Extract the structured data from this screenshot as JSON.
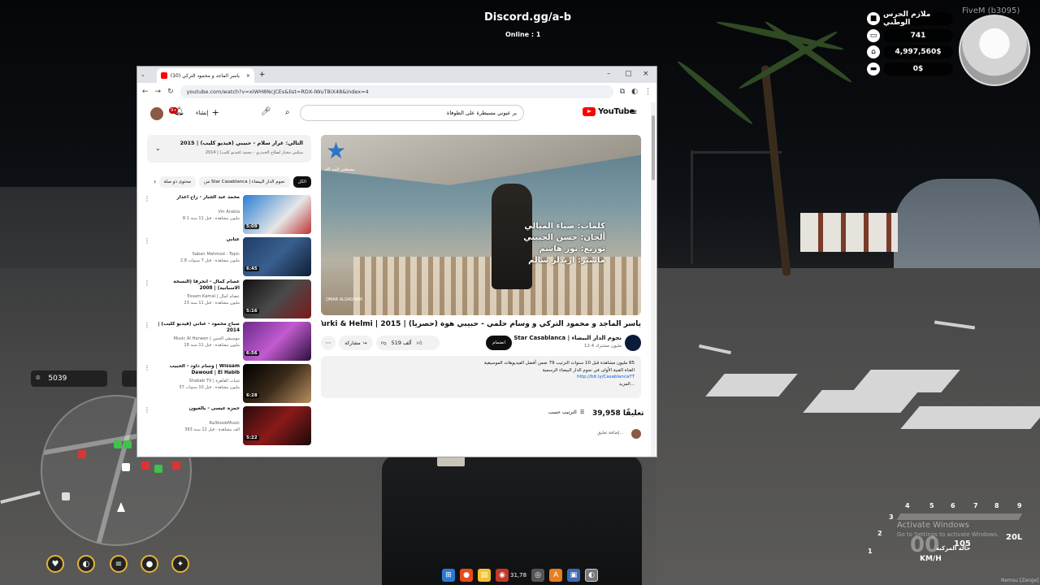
{
  "hud": {
    "discord": "Discord.gg/a-b",
    "online": "Online : 1",
    "fivem": "FiveM (b3095)",
    "rank": "ملازم الحرس الوطني",
    "id": "741",
    "bank": "4,997,560$",
    "cash": "0$",
    "location_code": "5039",
    "speed": "00",
    "speed_unit": "KM/H",
    "fuel": "20L",
    "activate_title": "Activate Windows",
    "activate_sub": "Go to Settings to activate Windows.",
    "vehicle_status": "حالة المركبة",
    "vehicle_num": "105",
    "gears": [
      "1",
      "2",
      "3",
      "4",
      "5",
      "6",
      "7",
      "8",
      "9"
    ],
    "bottom_right": "Nemsu [Zange]",
    "colors": {
      "accent": "#e2b43b",
      "hud_bg": "#000000"
    }
  },
  "taskbar": {
    "icons": [
      "windows-icon",
      "chrome-icon",
      "explorer-icon",
      "discord-icon",
      "steam-icon",
      "app-icon",
      "folder-icon",
      "chrome-active-icon"
    ],
    "badge": "31,78"
  },
  "browser": {
    "tab_title": "(10) ياسر الماجد و محمود التركي",
    "url": "youtube.com/watch?v=xIWH8NcjCEs&list=RDX-IWuT8iX48&index=4",
    "youtube_logo": "YouTube",
    "search_query": "ير عيوني مسيطرة على الطوفاة",
    "create_label": "إنشاء",
    "notif_count": "9+",
    "video": {
      "overlay_lines": [
        "كلمات: ضياء الميالي",
        "ألحان: حسن الحبيبي",
        "توزيع: نور هاشم",
        "ماستر: اريدلر سالم"
      ],
      "logo_text": "مصطفى العبد الله",
      "watermark": "OMAR ALSAGHAM",
      "title": "ياسر الماجد و محمود التركي و وسام حلمي - حبيبي هوة (حصرياً) | 2015 | Al Majed & Al Turki & Helmi",
      "channel": "Star Casablanca | نجوم الدار البيضاء",
      "subs": "12.4 مليون مشترك",
      "join": "انضمام",
      "likes": "519 ألف",
      "share": "مشاركة",
      "description_stats": "85 مليون مشاهدة قبل 10 سنوات  الترتيب 79 ضمن أفضل الفيديوهات الموسيقية",
      "description_line2": "القناة الفنية الأولى في نجوم الدار البيضاء الرسمية",
      "description_link": "http://bit.ly/CasablancaYT",
      "description_more": "...المزيد",
      "comments_count": "39,958 تعليقًا",
      "sort_label": "الترتيب حسب",
      "add_comment": "إضافة تعليق..."
    },
    "playlist": {
      "title": "التالي: غرار سلام - حبيبي (فيديو كليب) | 2015",
      "subtitle": "ميكس مختار لصلاح الحيدري - محمد (فيديو كليب) | 2014"
    },
    "chips": [
      "الكل",
      "من Star Casablanca | نجوم الدار البيضاء",
      "محتوى ذو صلة"
    ],
    "recs": [
      {
        "title": "محمد عبد الجبار - زاح اعذار",
        "channel": "Vin Arabia",
        "meta": "8.1 مليون مشاهدة · قبل 11 سنة",
        "duration": "5:09"
      },
      {
        "title": "عتابي",
        "channel": "Saban Mahmod - Topic",
        "meta": "2.8 مليون مشاهدة · قبل 7 سنوات",
        "duration": "6:45"
      },
      {
        "title": "عصام كمال - انحرقا (النسخة الاسبانية) | 2008",
        "channel": "Essam Kamal | عصام كمال",
        "meta": "23 مليون مشاهدة · قبل 11 سنة",
        "duration": "5:16"
      },
      {
        "title": "صباح محمود - عتابي (فيديو كليب) | 2014",
        "channel": "Music Al Haneen | موسيقى الحنين",
        "meta": "18 مليون مشاهدة · قبل 11 سنة",
        "duration": "6:56"
      },
      {
        "title": "وسام داود - الحبيب | Wissam Dawoud | El Habib",
        "channel": "Shabab TV | شباب القاهرة",
        "meta": "37 مليون مشاهدة · قبل 10 سنوات",
        "duration": "6:28"
      },
      {
        "title": "حمزة عيسى - يالعيون",
        "channel": "Ra3boobMusic",
        "meta": "393 ألف مشاهدة · قبل 12 سنة",
        "duration": "5:22"
      }
    ]
  }
}
